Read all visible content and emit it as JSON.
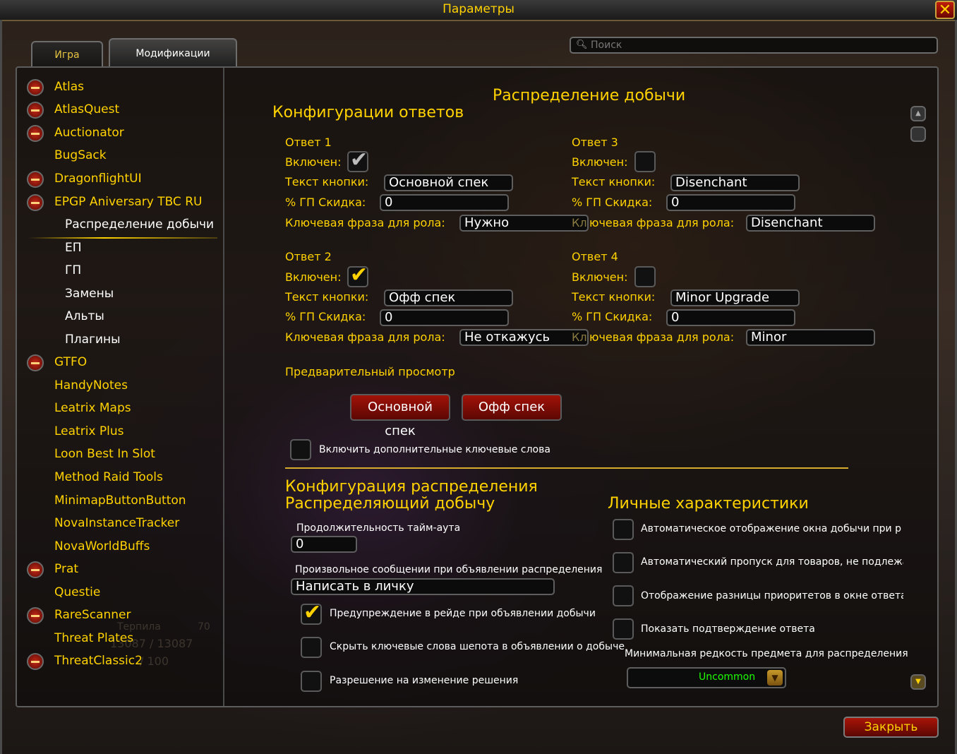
{
  "window": {
    "title": "Параметры",
    "close_glyph": "✕"
  },
  "tabs": [
    "Игра",
    "Модификации"
  ],
  "search": {
    "placeholder": "Поиск"
  },
  "sidebar": {
    "items": [
      {
        "label": "Atlas",
        "collapse": true
      },
      {
        "label": "AtlasQuest",
        "collapse": true
      },
      {
        "label": "Auctionator",
        "collapse": true
      },
      {
        "label": "BugSack",
        "collapse": false
      },
      {
        "label": "DragonflightUI",
        "collapse": true
      },
      {
        "label": "EPGP Aniversary TBC RU",
        "collapse": true
      }
    ],
    "subitems": [
      "Распределение добычи",
      "ЕП",
      "ГП",
      "Замены",
      "Альты",
      "Плагины"
    ],
    "items2": [
      {
        "label": "GTFO",
        "collapse": true
      },
      {
        "label": "HandyNotes",
        "collapse": false
      },
      {
        "label": "Leatrix Maps",
        "collapse": false
      },
      {
        "label": "Leatrix Plus",
        "collapse": false
      },
      {
        "label": "Loon Best In Slot",
        "collapse": false
      },
      {
        "label": "Method Raid Tools",
        "collapse": false
      },
      {
        "label": "MinimapButtonButton",
        "collapse": false
      },
      {
        "label": "NovaInstanceTracker",
        "collapse": false
      },
      {
        "label": "NovaWorldBuffs",
        "collapse": false
      },
      {
        "label": "Prat",
        "collapse": true
      },
      {
        "label": "Questie",
        "collapse": false
      },
      {
        "label": "RareScanner",
        "collapse": true
      },
      {
        "label": "Threat Plates",
        "collapse": false
      },
      {
        "label": "ThreatClassic2",
        "collapse": true
      }
    ]
  },
  "background_text": {
    "name": "Терпила",
    "level": "70",
    "hp": "13087 / 13087",
    "mana": "/ 100"
  },
  "main": {
    "page_title": "Распределение добычи",
    "responses_heading": "Конфигурации ответов",
    "labels": {
      "enabled": "Включен:",
      "button_text": "Текст кнопки:",
      "gp_discount": "% ГП Скидка:",
      "keyphrase": "Ключевая фраза для рола:",
      "keyphrase_tail": "ючевая фраза для рола:",
      "kl_prefix": "Кл"
    },
    "responses": [
      {
        "title": "Ответ 1",
        "enabled": true,
        "button_text": "Основной спек",
        "gp": "0",
        "keyphrase": "Нужно"
      },
      {
        "title": "Ответ 2",
        "enabled": true,
        "button_text": "Офф спек",
        "gp": "0",
        "keyphrase": "Не откажусь"
      },
      {
        "title": "Ответ 3",
        "enabled": false,
        "button_text": "Disenchant",
        "gp": "0",
        "keyphrase": "Disenchant"
      },
      {
        "title": "Ответ 4",
        "enabled": false,
        "button_text": "Minor Upgrade",
        "gp": "0",
        "keyphrase": "Minor"
      }
    ],
    "preview_label": "Предварительный просмотр",
    "preview_buttons": [
      "Основной спек",
      "Офф спек"
    ],
    "extra_keywords_label": "Включить дополнительные ключевые слова",
    "distribution_heading_1": "Конфигурация распределения",
    "distribution_heading_2": "Распределяющий добычу",
    "timeout_label": "Продолжительность тайм-аута",
    "timeout_value": "0",
    "custom_msg_label": "Произвольное сообщении при объявлении распределения",
    "custom_msg_value": "Написать в личку",
    "dist_checks": [
      {
        "label": "Предупреждение в рейде при объявлении добычи",
        "checked": true
      },
      {
        "label": "Скрыть ключевые слова шепота в объявлении о добыче",
        "checked": false
      },
      {
        "label": "Разрешение на изменение решения",
        "checked": false
      }
    ],
    "personal_heading": "Личные характеристики",
    "personal_checks": [
      {
        "label": "Автоматическое отображение окна добычи при р",
        "checked": false
      },
      {
        "label": "Автоматический пропуск для товаров, не подлежа",
        "checked": false
      },
      {
        "label": "Отображение разницы приоритетов в окне ответа",
        "checked": false
      },
      {
        "label": "Показать подтверждение ответа",
        "checked": false
      }
    ],
    "min_rarity_label": "Минимальная редкость предмета для распределения",
    "min_rarity_value": "Uncommon",
    "colors": {
      "gold": "#ffd200",
      "uncommon": "#1eff00",
      "button_red": "#a11208"
    }
  },
  "footer": {
    "close_label": "Закрыть"
  }
}
